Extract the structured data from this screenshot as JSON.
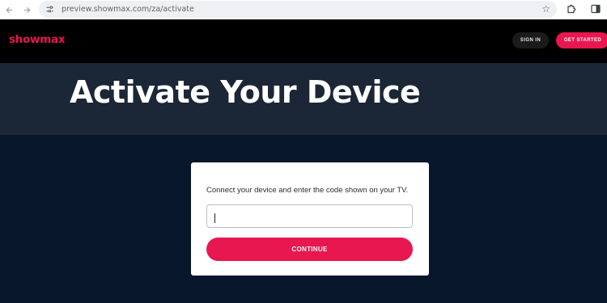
{
  "browser": {
    "url": "preview.showmax.com/za/activate",
    "icons": {
      "back": "arrow-left-icon",
      "forward": "arrow-right-icon",
      "reload": "reload-icon",
      "site_info": "tune-icon",
      "bookmark": "star-icon",
      "extensions": "puzzle-icon",
      "side_panel": "side-panel-icon"
    }
  },
  "header": {
    "logo": "showmax",
    "sign_in_label": "SIGN IN",
    "get_started_label": "GET STARTED"
  },
  "hero": {
    "title": "Activate Your Device"
  },
  "activation": {
    "instruction": "Connect your device and enter the code shown on your TV.",
    "code_value": "",
    "continue_label": "CONTINUE"
  },
  "colors": {
    "brand": "#e8174f",
    "header_bg": "#000000",
    "hero_bg": "#1b2636",
    "page_bg": "#07162a"
  }
}
